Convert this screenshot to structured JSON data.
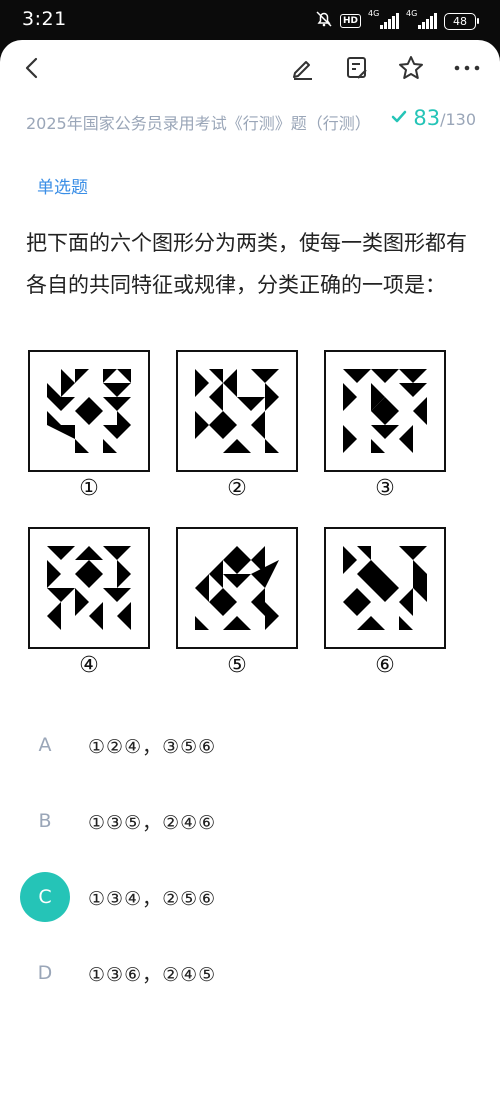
{
  "status": {
    "time": "3:21",
    "hd": "HD",
    "net1": "4G",
    "net2": "4G",
    "battery": "48"
  },
  "nav": {
    "back_icon": "back-arrow-icon",
    "edit_icon": "pencil-icon",
    "note_icon": "note-edit-icon",
    "star_icon": "star-icon",
    "more_icon": "more-dots-icon"
  },
  "header": {
    "breadcrumb": "2025年国家公务员录用考试《行测》题（行测）",
    "progress_current": "83",
    "progress_total": "/130"
  },
  "question": {
    "type": "单选题",
    "text": "把下面的六个图形分为两类，使每一类图形都有各自的共同特征或规律，分类正确的一项是：",
    "figures": [
      {
        "label": "①"
      },
      {
        "label": "②"
      },
      {
        "label": "③"
      },
      {
        "label": "④"
      },
      {
        "label": "⑤"
      },
      {
        "label": "⑥"
      }
    ]
  },
  "options": [
    {
      "letter": "A",
      "text": "①②④，③⑤⑥",
      "selected": false
    },
    {
      "letter": "B",
      "text": "①③⑤，②④⑥",
      "selected": false
    },
    {
      "letter": "C",
      "text": "①③④，②⑤⑥",
      "selected": true
    },
    {
      "letter": "D",
      "text": "①③⑥，②④⑤",
      "selected": false
    }
  ],
  "colors": {
    "accent": "#25c4b7",
    "link": "#3a8ee6",
    "muted": "#9aa6b8"
  }
}
